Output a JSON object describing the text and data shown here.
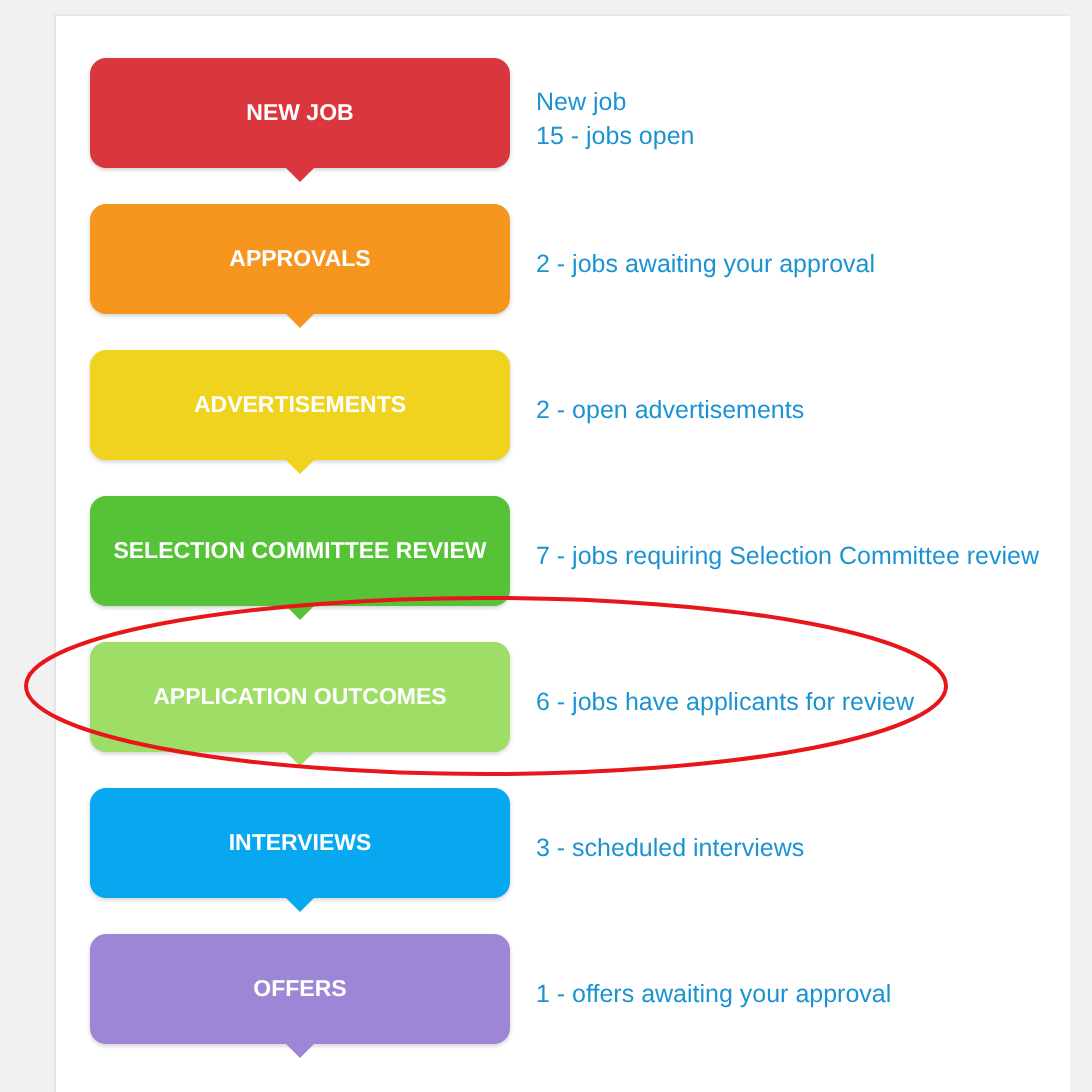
{
  "steps": [
    {
      "label": "NEW JOB",
      "color": "#d9363e",
      "lines": [
        "New job",
        "15 - jobs open"
      ],
      "circled": false
    },
    {
      "label": "APPROVALS",
      "color": "#f7961e",
      "lines": [
        "2 - jobs awaiting your approval"
      ],
      "circled": false
    },
    {
      "label": "ADVERTISEMENTS",
      "color": "#f0d31e",
      "lines": [
        "2 - open advertisements"
      ],
      "circled": false
    },
    {
      "label": "SELECTION COMMITTEE REVIEW",
      "color": "#55c237",
      "lines": [
        "7 - jobs requiring Selection Committee review"
      ],
      "circled": false
    },
    {
      "label": "APPLICATION OUTCOMES",
      "color": "#9edd66",
      "lines": [
        "6 - jobs have applicants for review"
      ],
      "circled": true
    },
    {
      "label": "INTERVIEWS",
      "color": "#08a8f0",
      "lines": [
        "3 - scheduled interviews"
      ],
      "circled": false
    },
    {
      "label": "OFFERS",
      "color": "#9d86d6",
      "lines": [
        "1 - offers awaiting your approval"
      ],
      "circled": false
    }
  ]
}
